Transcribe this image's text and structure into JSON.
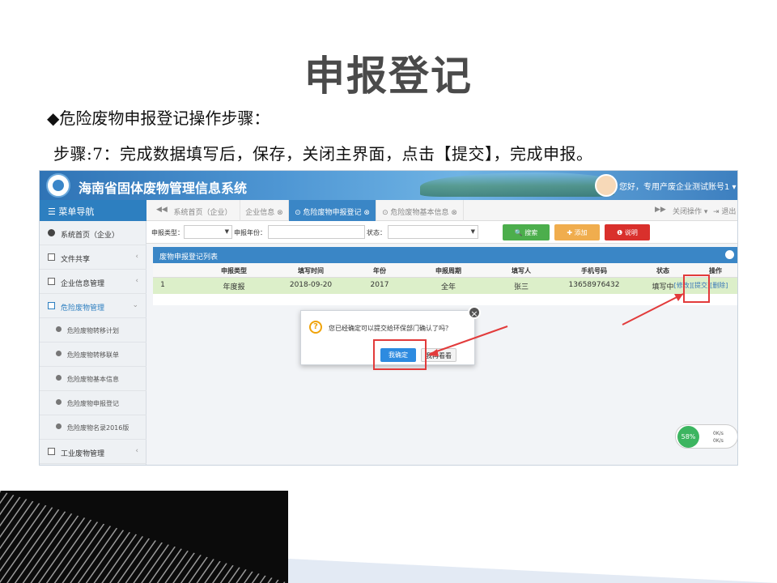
{
  "slide": {
    "title": "申报登记",
    "step_heading": "◆危险废物申报登记操作步骤：",
    "step_text": "步骤:7：完成数据填写后，保存，关闭主界面，点击【提交】，完成申报。"
  },
  "app": {
    "title": "海南省固体废物管理信息系统",
    "user_greeting": "您好，专用产废企业测试账号1",
    "menu_heading": "菜单导航",
    "tabs": [
      {
        "label": "系统首页（企业）",
        "active": false
      },
      {
        "label": "企业信息",
        "active": false
      },
      {
        "label": "危险废物申报登记",
        "active": true
      },
      {
        "label": "危险废物基本信息",
        "active": false
      }
    ],
    "tab_tools": {
      "close_ops": "关闭操作",
      "logout": "退出"
    },
    "sidebar": [
      {
        "label": "系统首页（企业）",
        "type": "top"
      },
      {
        "label": "文件共享",
        "type": "top"
      },
      {
        "label": "企业信息管理",
        "type": "top"
      },
      {
        "label": "危险废物管理",
        "type": "open"
      },
      {
        "label": "危险废物转移计划",
        "type": "sub"
      },
      {
        "label": "危险废物转移联单",
        "type": "sub"
      },
      {
        "label": "危险废物基本信息",
        "type": "sub"
      },
      {
        "label": "危险废物申报登记",
        "type": "sub"
      },
      {
        "label": "危险废物名录2016版",
        "type": "sub"
      },
      {
        "label": "工业废物管理",
        "type": "top"
      }
    ],
    "filter": {
      "type_label": "申报类型：",
      "year_label": "申报年份：",
      "status_label": "状态：",
      "search_btn": "搜索",
      "add_btn": "添加",
      "help_btn": "说明"
    },
    "list": {
      "title": "废物申报登记列表",
      "columns": [
        "申报类型",
        "填写时间",
        "年份",
        "申报周期",
        "填写人",
        "手机号码",
        "状态",
        "操作"
      ],
      "rows": [
        {
          "index": "1",
          "type": "年度报",
          "date": "2018-09-20",
          "year": "2017",
          "cycle": "全年",
          "person": "张三",
          "phone": "13658976432",
          "status": "填写中",
          "actions": [
            "[修改]",
            "[提交]",
            "[删除]"
          ]
        }
      ]
    },
    "dialog": {
      "question": "您已经确定可以提交给环保部门确认了吗？",
      "confirm": "我确定",
      "cancel": "我再看看"
    },
    "net_widget": {
      "percent": "58%",
      "up": "0K/s",
      "down": "0K/s"
    }
  },
  "colors": {
    "accent": "#2d7fc0",
    "highlight": "#e23b3b",
    "row_bg": "#dcefc9"
  }
}
